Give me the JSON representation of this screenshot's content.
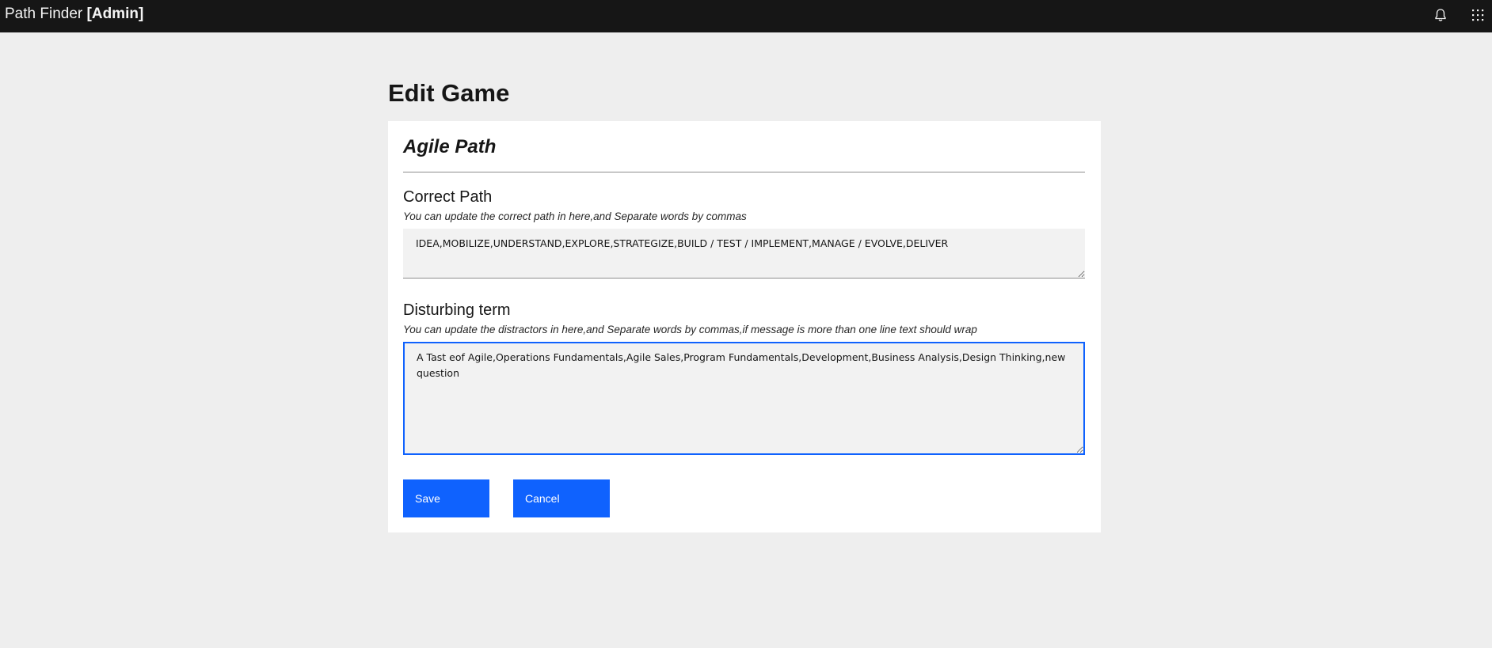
{
  "app": {
    "name": "Path Finder",
    "role": "[Admin]"
  },
  "icons": {
    "notifications": "bell-icon",
    "app_switcher": "grid-icon"
  },
  "page": {
    "title": "Edit Game"
  },
  "game": {
    "name": "Agile Path"
  },
  "correct_path": {
    "label": "Correct Path",
    "help": "You can update the correct path in here,and Separate words by commas",
    "value": "IDEA,MOBILIZE,UNDERSTAND,EXPLORE,STRATEGIZE,BUILD / TEST / IMPLEMENT,MANAGE / EVOLVE,DELIVER"
  },
  "disturbing_term": {
    "label": "Disturbing term",
    "help": "You can update the distractors in here,and Separate words by commas,if message is more than one line text should wrap",
    "value": "A Tast eof Agile,Operations Fundamentals,Agile Sales,Program Fundamentals,Development,Business Analysis,Design Thinking,new question"
  },
  "actions": {
    "save_label": "Save",
    "cancel_label": "Cancel"
  },
  "colors": {
    "topbar_bg": "#161616",
    "page_bg": "#eeeeee",
    "primary": "#0f62fe",
    "field_bg": "#f2f2f2"
  }
}
